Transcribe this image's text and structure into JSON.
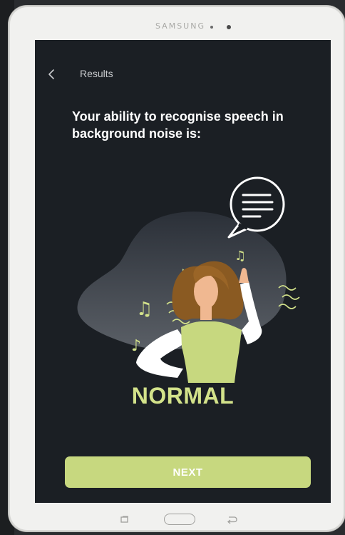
{
  "device": {
    "brand": "SAMSUNG"
  },
  "header": {
    "back_icon": "chevron-left-icon",
    "title": "Results"
  },
  "content": {
    "headline": "Your ability to recognise speech in background noise is:",
    "result": "NORMAL",
    "illustration_icon": "person-listening-illustration"
  },
  "actions": {
    "next_label": "NEXT"
  },
  "navigation_bar": {
    "recents_icon": "recents-icon",
    "home_icon": "home-button-icon",
    "back_icon": "back-arrow-icon"
  },
  "colors": {
    "screen_bg": "#1b1f24",
    "accent": "#c7d87f",
    "result_text": "#d3e28a",
    "text": "#ffffff"
  }
}
